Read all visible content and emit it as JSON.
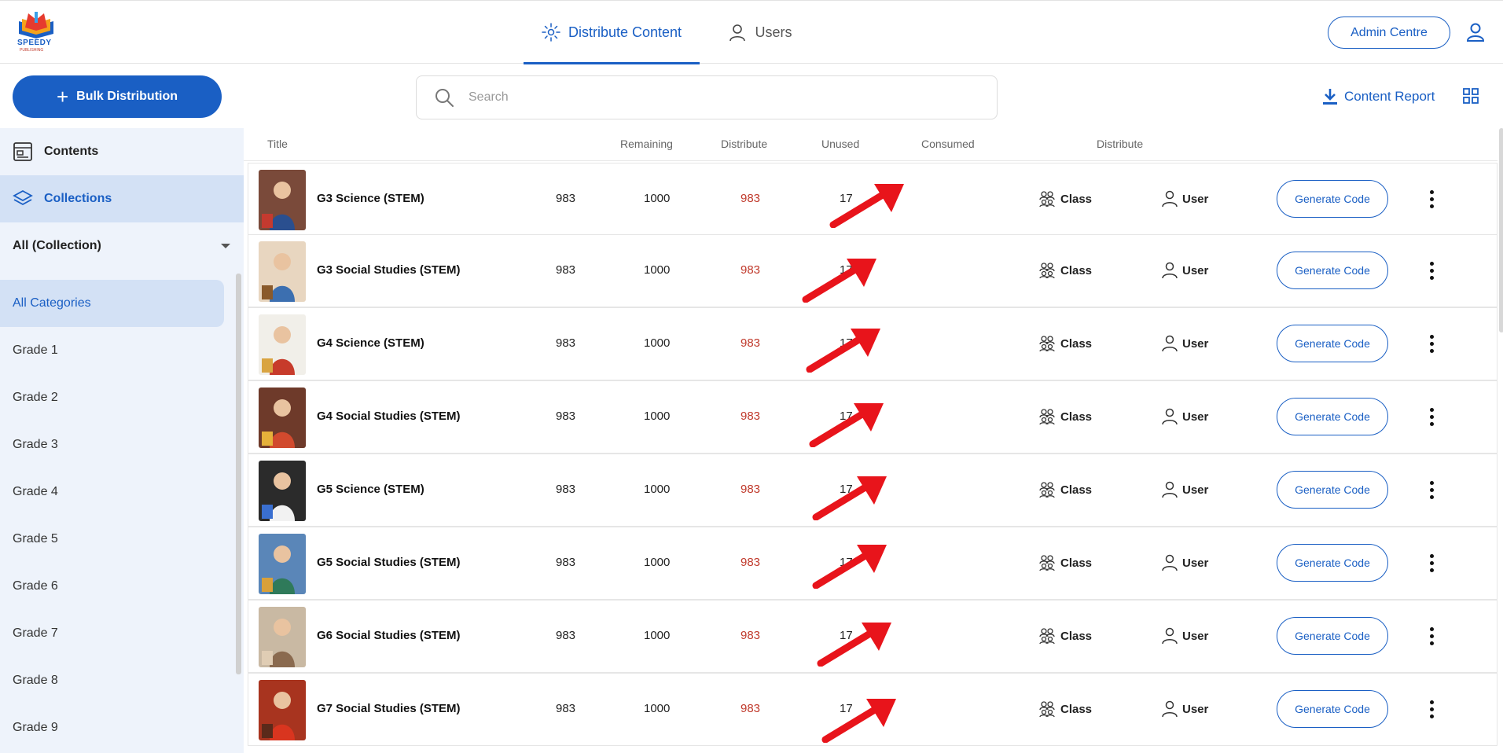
{
  "brand": {
    "logo_text": "SPEEDY",
    "logo_subtext": "PUBLISHING"
  },
  "nav": {
    "tabs": [
      {
        "label": "Distribute Content",
        "icon": "sparkle-icon",
        "active": true
      },
      {
        "label": "Users",
        "icon": "user-icon",
        "active": false
      }
    ],
    "admin_label": "Admin Centre"
  },
  "toolbar": {
    "bulk_label": "Bulk Distribution",
    "search_placeholder": "Search",
    "report_label": "Content Report"
  },
  "sidebar": {
    "contents_label": "Contents",
    "collections_label": "Collections",
    "filter_label": "All (Collection)",
    "categories": [
      "All Categories",
      "Grade 1",
      "Grade 2",
      "Grade 3",
      "Grade 4",
      "Grade 5",
      "Grade 6",
      "Grade 7",
      "Grade 8",
      "Grade 9"
    ]
  },
  "table": {
    "headers": {
      "title": "Title",
      "remaining": "Remaining",
      "distribute": "Distribute",
      "unused": "Unused",
      "consumed": "Consumed",
      "distribute2": "Distribute"
    },
    "class_label": "Class",
    "user_label": "User",
    "generate_label": "Generate Code",
    "rows": [
      {
        "title": "G3 Science (STEM)",
        "remaining": "983",
        "distribute": "1000",
        "unused": "983",
        "consumed": "17"
      },
      {
        "title": "G3 Social Studies (STEM)",
        "remaining": "983",
        "distribute": "1000",
        "unused": "983",
        "consumed": "17"
      },
      {
        "title": "G4 Science (STEM)",
        "remaining": "983",
        "distribute": "1000",
        "unused": "983",
        "consumed": "17"
      },
      {
        "title": "G4 Social Studies (STEM)",
        "remaining": "983",
        "distribute": "1000",
        "unused": "983",
        "consumed": "17"
      },
      {
        "title": "G5 Science (STEM)",
        "remaining": "983",
        "distribute": "1000",
        "unused": "983",
        "consumed": "17"
      },
      {
        "title": "G5 Social Studies (STEM)",
        "remaining": "983",
        "distribute": "1000",
        "unused": "983",
        "consumed": "17"
      },
      {
        "title": "G6 Social Studies (STEM)",
        "remaining": "983",
        "distribute": "1000",
        "unused": "983",
        "consumed": "17"
      },
      {
        "title": "G7 Social Studies (STEM)",
        "remaining": "983",
        "distribute": "1000",
        "unused": "983",
        "consumed": "17"
      }
    ]
  },
  "colors": {
    "accent": "#1a5fc4",
    "unused": "#c0392b",
    "annotation_arrow": "#e8141b",
    "sidebar_bg": "#eef3fb",
    "sidebar_active": "#d3e1f5"
  }
}
